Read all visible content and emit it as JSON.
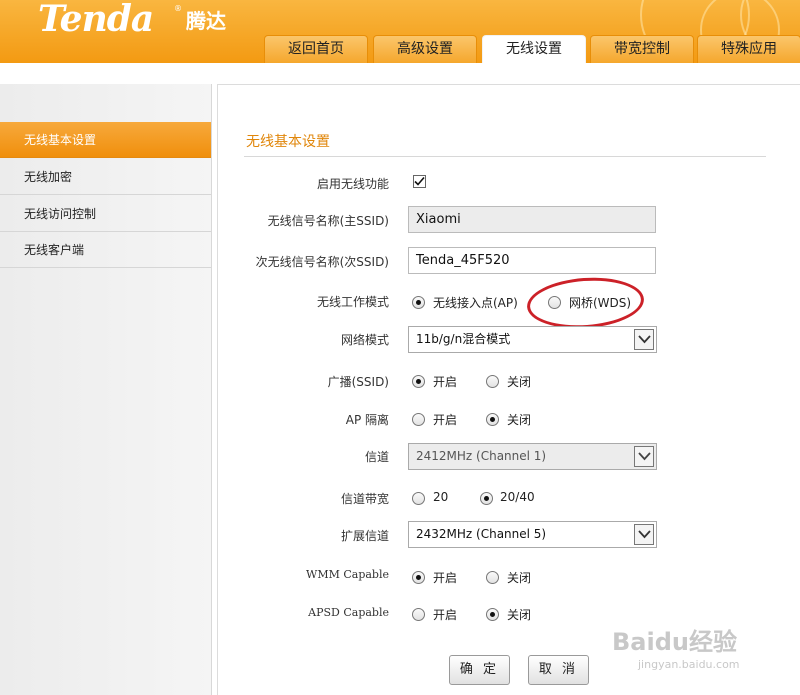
{
  "brand": {
    "logo": "Tenda",
    "logo_cn": "腾达",
    "reg": "®"
  },
  "tabs": [
    {
      "label": "返回首页"
    },
    {
      "label": "高级设置"
    },
    {
      "label": "无线设置"
    },
    {
      "label": "带宽控制"
    },
    {
      "label": "特殊应用"
    }
  ],
  "sidebar": {
    "items": [
      {
        "label": "无线基本设置"
      },
      {
        "label": "无线加密"
      },
      {
        "label": "无线访问控制"
      },
      {
        "label": "无线客户端"
      }
    ]
  },
  "form": {
    "title": "无线基本设置",
    "enable_wireless": {
      "label": "启用无线功能",
      "checked": true
    },
    "primary_ssid": {
      "label": "无线信号名称(主SSID)",
      "value": "Xiaomi"
    },
    "secondary_ssid": {
      "label": "次无线信号名称(次SSID)",
      "value": "Tenda_45F520"
    },
    "work_mode": {
      "label": "无线工作模式",
      "options": [
        "无线接入点(AP)",
        "网桥(WDS)"
      ],
      "selected": "无线接入点(AP)"
    },
    "network_mode": {
      "label": "网络模式",
      "value": "11b/g/n混合模式"
    },
    "broadcast": {
      "label": "广播(SSID)",
      "options": [
        "开启",
        "关闭"
      ],
      "selected": "开启"
    },
    "ap_isolation": {
      "label": "AP 隔离",
      "options": [
        "开启",
        "关闭"
      ],
      "selected": "关闭"
    },
    "channel": {
      "label": "信道",
      "value": "2412MHz (Channel 1)"
    },
    "bandwidth": {
      "label": "信道带宽",
      "options": [
        "20",
        "20/40"
      ],
      "selected": "20/40"
    },
    "ext_channel": {
      "label": "扩展信道",
      "value": "2432MHz (Channel 5)"
    },
    "wmm": {
      "label": "WMM Capable",
      "options": [
        "开启",
        "关闭"
      ],
      "selected": "开启"
    },
    "apsd": {
      "label": "APSD Capable",
      "options": [
        "开启",
        "关闭"
      ],
      "selected": "关闭"
    }
  },
  "buttons": {
    "ok": "确 定",
    "cancel": "取 消"
  },
  "watermark": {
    "logo": "Baidu经验",
    "url": "jingyan.baidu.com"
  },
  "colors": {
    "accent": "#f39a12",
    "title": "#e0860a",
    "highlight_ellipse": "#cc2128"
  }
}
